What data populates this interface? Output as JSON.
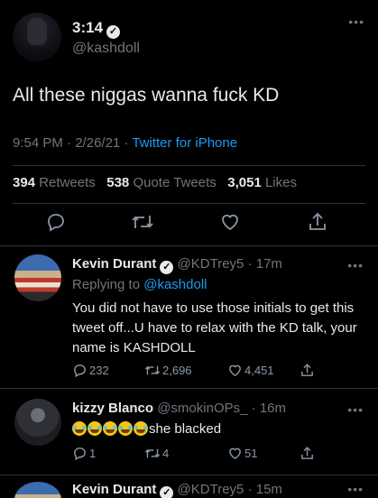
{
  "tweet": {
    "display_name": "3:14",
    "handle": "@kashdoll",
    "text": "All these niggas wanna fuck KD",
    "time": "9:54 PM",
    "date": "2/26/21",
    "source": "Twitter for iPhone",
    "retweets_count": "394",
    "retweets_label": "Retweets",
    "quotes_count": "538",
    "quotes_label": "Quote Tweets",
    "likes_count": "3,051",
    "likes_label": "Likes",
    "dots": "•••"
  },
  "actions": [
    "reply-icon",
    "retweet-icon",
    "like-icon",
    "share-icon"
  ],
  "replies": [
    {
      "name": "Kevin Durant",
      "handle": "@KDTrey5",
      "age": "17m",
      "replying_label": "Replying to",
      "replying_handle": "@kashdoll",
      "text": "You did not have to use those initials to get this tweet off...U have to relax with the KD talk, your name is KASHDOLL",
      "replies": "232",
      "retweets": "2,696",
      "likes": "4,451"
    },
    {
      "name": "kizzy Blanco",
      "handle": "@smokinOPs_",
      "age": "16m",
      "emoji": "😂😂😂😂😂",
      "text": "she blacked",
      "replies": "1",
      "retweets": "4",
      "likes": "51"
    },
    {
      "name": "Kevin Durant",
      "handle": "@KDTrey5",
      "age": "15m"
    }
  ],
  "separator": "·"
}
